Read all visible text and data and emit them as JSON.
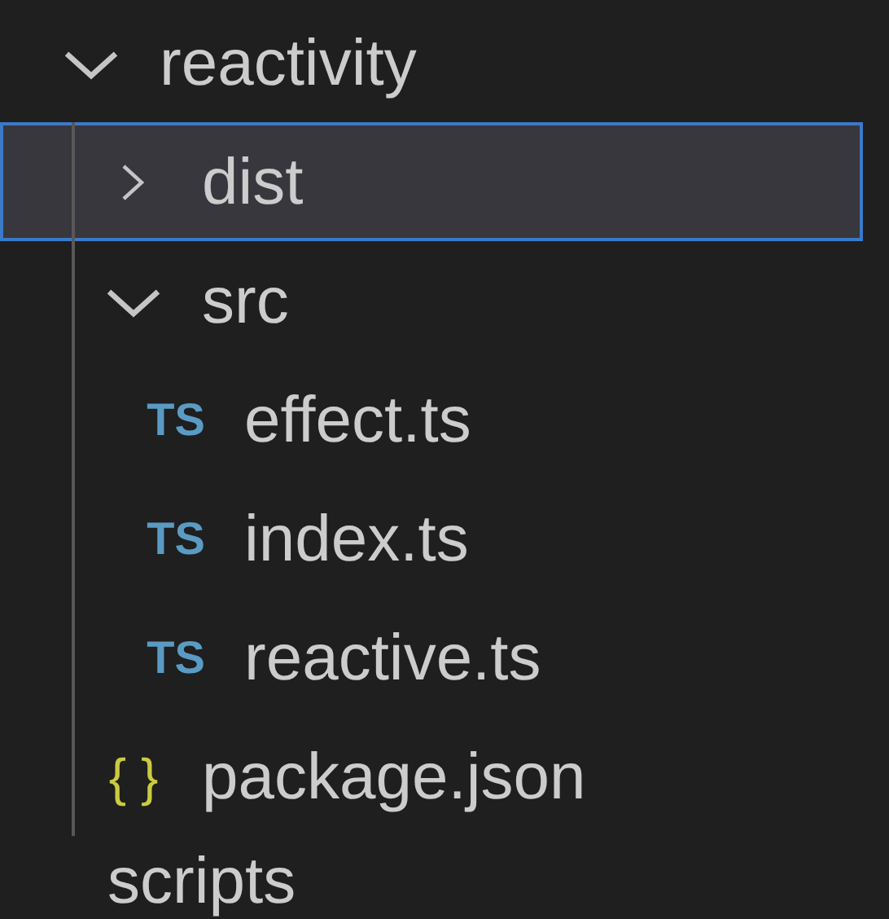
{
  "explorer": {
    "items": [
      {
        "kind": "folder",
        "label": "reactivity",
        "expanded": true,
        "selected": false,
        "children": [
          {
            "kind": "folder",
            "label": "dist",
            "expanded": false,
            "selected": true
          },
          {
            "kind": "folder",
            "label": "src",
            "expanded": true,
            "selected": false,
            "children": [
              {
                "kind": "file",
                "icon_text": "TS",
                "color": "#5a9bc4",
                "label": "effect.ts",
                "selected": false
              },
              {
                "kind": "file",
                "icon_text": "TS",
                "color": "#5a9bc4",
                "label": "index.ts",
                "selected": false
              },
              {
                "kind": "file",
                "icon_text": "TS",
                "color": "#5a9bc4",
                "label": "reactive.ts",
                "selected": false
              }
            ]
          },
          {
            "kind": "file",
            "icon_text": "{ }",
            "color": "#cbcb41",
            "label": "package.json",
            "selected": false
          }
        ]
      },
      {
        "kind": "label",
        "label": "scripts",
        "selected": false
      }
    ]
  }
}
